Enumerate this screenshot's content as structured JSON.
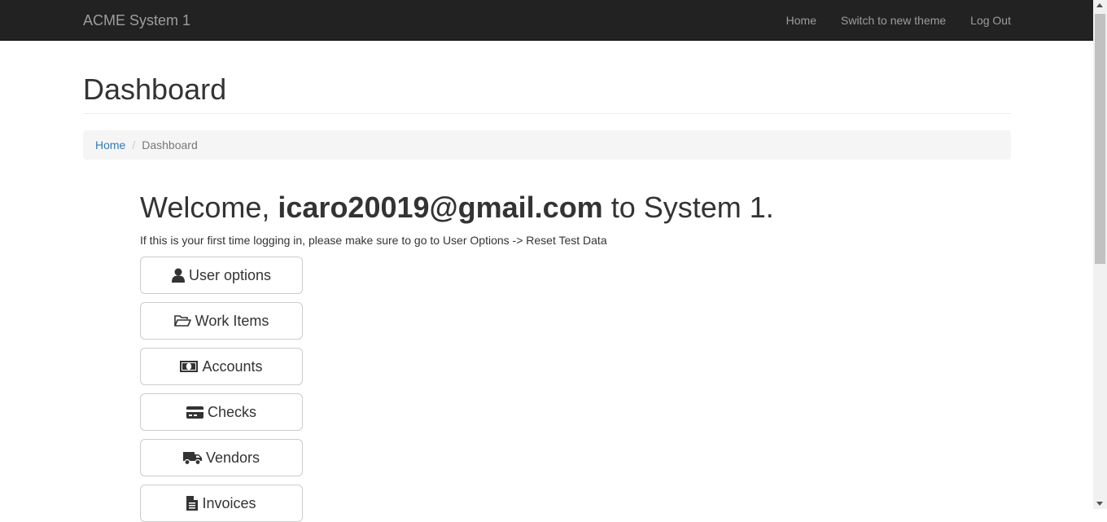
{
  "navbar": {
    "brand": "ACME System 1",
    "links": [
      "Home",
      "Switch to new theme",
      "Log Out"
    ]
  },
  "page": {
    "title": "Dashboard"
  },
  "breadcrumb": {
    "home": "Home",
    "separator": "/",
    "current": "Dashboard"
  },
  "welcome": {
    "prefix": "Welcome, ",
    "email": "icaro20019@gmail.com",
    "suffix": " to System 1.",
    "note": "If this is your first time logging in, please make sure to go to User Options -> Reset Test Data"
  },
  "menu": [
    {
      "label": "User options",
      "icon": "user-icon"
    },
    {
      "label": "Work Items",
      "icon": "folder-open-icon"
    },
    {
      "label": "Accounts",
      "icon": "money-icon"
    },
    {
      "label": "Checks",
      "icon": "credit-card-icon"
    },
    {
      "label": "Vendors",
      "icon": "truck-icon"
    },
    {
      "label": "Invoices",
      "icon": "file-text-icon"
    }
  ],
  "colors": {
    "navbar_bg": "#222222",
    "navbar_text": "#9d9d9d",
    "link": "#337ab7",
    "breadcrumb_bg": "#f5f5f5"
  }
}
